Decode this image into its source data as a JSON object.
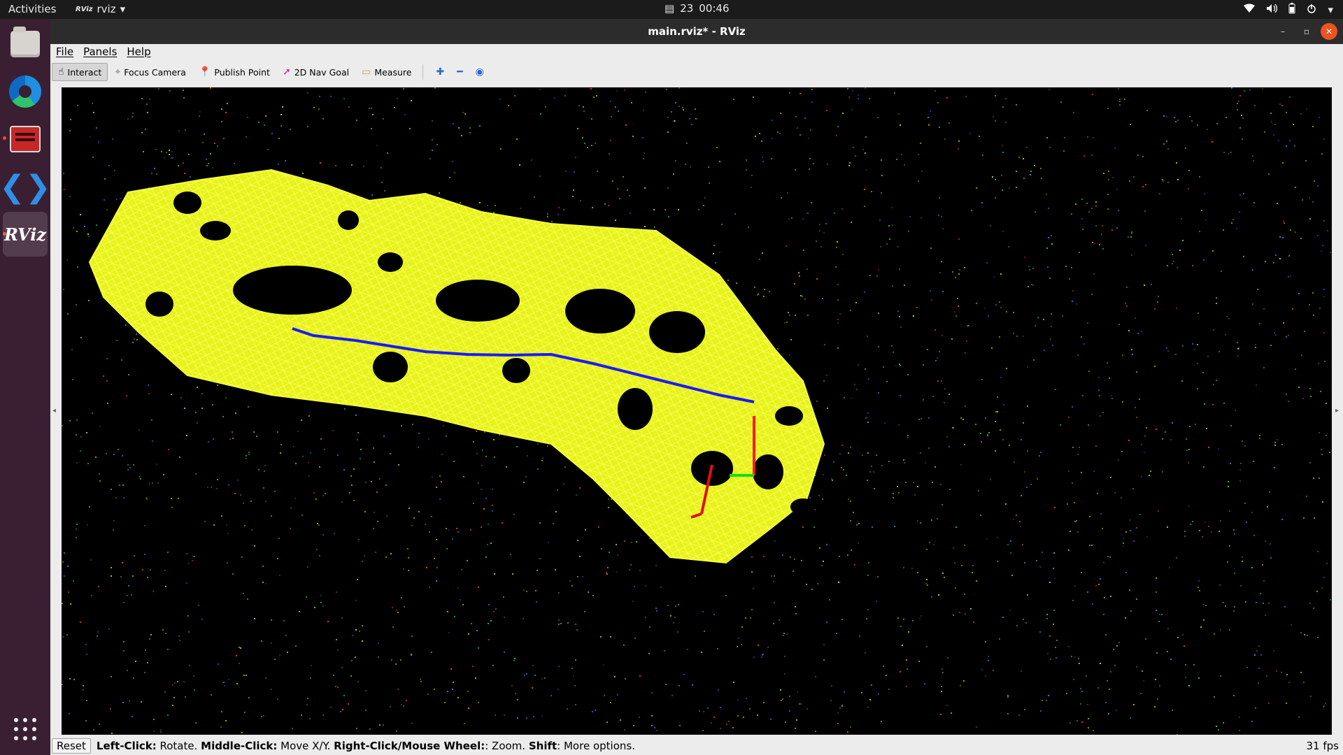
{
  "topbar": {
    "activities": "Activities",
    "app_name": "rviz",
    "app_icon_text": "RViz",
    "date_day": "23",
    "time": "00:46",
    "tray_icons": [
      "wifi-icon",
      "volume-icon",
      "battery-icon",
      "power-menu-icon"
    ]
  },
  "dock": {
    "items": [
      "Files",
      "Microsoft Edge",
      "Terminal",
      "Visual Studio Code",
      "RViz"
    ],
    "rviz_label": "RViz",
    "vscode_glyph": "❮❯"
  },
  "window": {
    "title": "main.rviz* - RViz",
    "close_glyph": "✕",
    "minimize_glyph": "–",
    "maximize_glyph": "▫"
  },
  "menubar": {
    "file": "File",
    "panels": "Panels",
    "help": "Help"
  },
  "toolbar": {
    "interact": "Interact",
    "focus_camera": "Focus Camera",
    "publish_point": "Publish Point",
    "nav_goal": "2D Nav Goal",
    "measure": "Measure",
    "add_tool_glyph": "✚",
    "remove_tool_glyph": "━",
    "view_glyph": "◉"
  },
  "statusbar": {
    "reset": "Reset",
    "left_click_key": "Left-Click:",
    "left_click_action": " Rotate. ",
    "middle_click_key": "Middle-Click:",
    "middle_click_action": " Move X/Y. ",
    "right_click_key": "Right-Click/Mouse Wheel:",
    "right_click_action": ": Zoom. ",
    "shift_key": "Shift",
    "shift_action": ": More options.",
    "fps": "31 fps"
  },
  "colors": {
    "mesh": "#f0ff1e",
    "path": "#1a1aff",
    "axis_x": "#ff1a1a",
    "axis_y": "#10e010",
    "accent": "#e95420"
  }
}
